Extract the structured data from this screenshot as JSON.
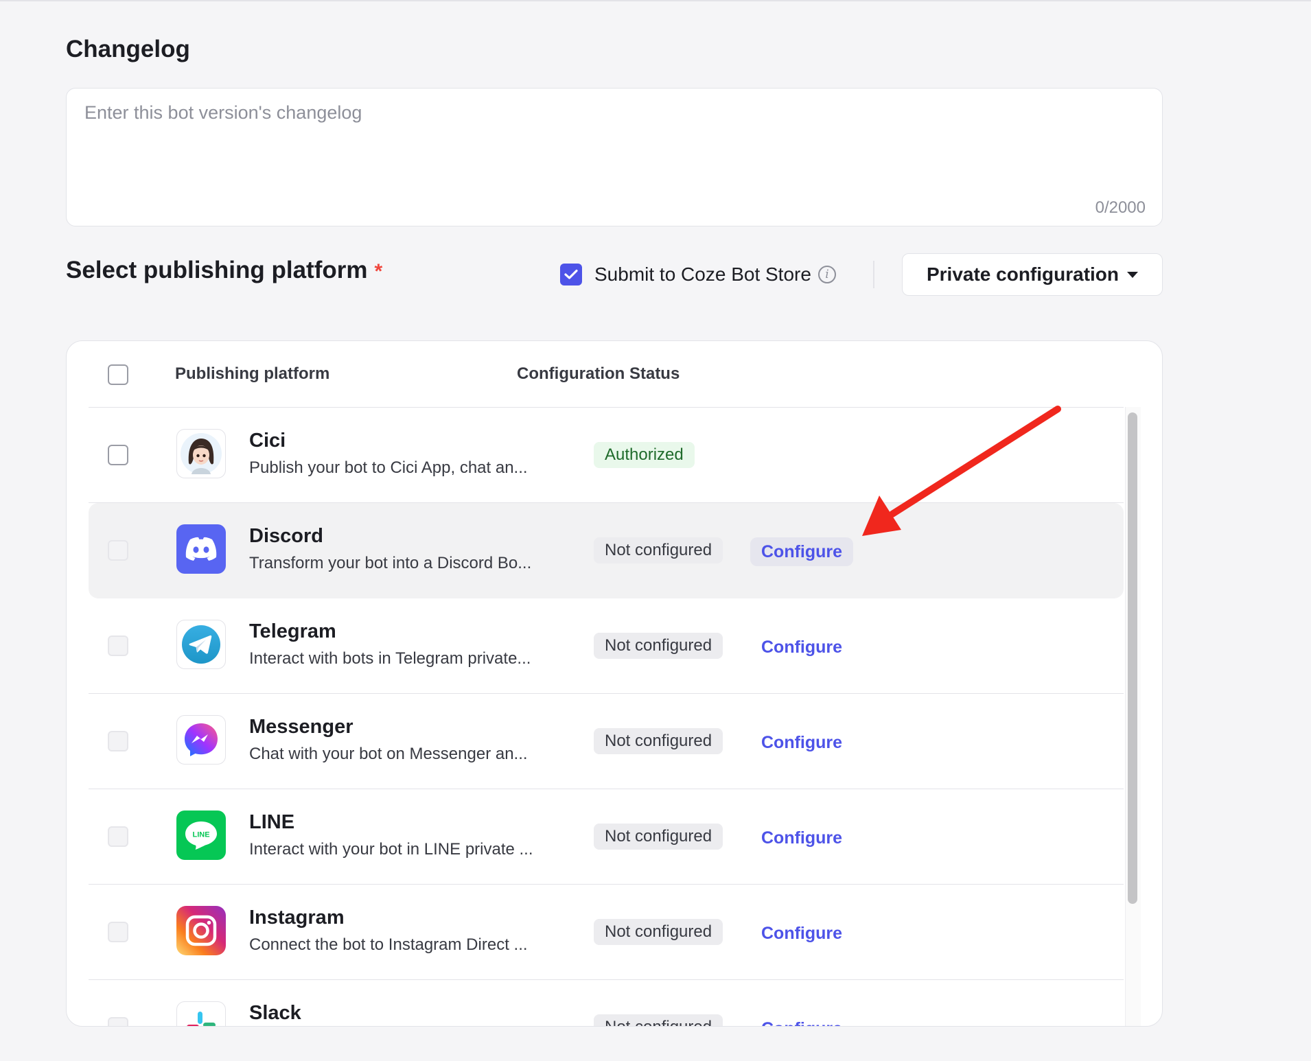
{
  "changelog": {
    "title": "Changelog",
    "placeholder": "Enter this bot version's changelog",
    "counter": "0/2000"
  },
  "publishing": {
    "title": "Select publishing platform",
    "required_mark": "*",
    "submit_label": "Submit to Coze Bot Store",
    "submit_checked": true,
    "private_config_label": "Private configuration"
  },
  "table": {
    "col_platform": "Publishing platform",
    "col_status": "Configuration Status",
    "rows": [
      {
        "name": "Cici",
        "desc": "Publish your bot to Cici App, chat an...",
        "status": "Authorized",
        "configure": "",
        "logo": "cici-avatar-icon",
        "checkbox_enabled": true
      },
      {
        "name": "Discord",
        "desc": "Transform your bot into a Discord Bo...",
        "status": "Not configured",
        "configure": "Configure",
        "logo": "discord-icon",
        "checkbox_enabled": false
      },
      {
        "name": "Telegram",
        "desc": "Interact with bots in Telegram private...",
        "status": "Not configured",
        "configure": "Configure",
        "logo": "telegram-icon",
        "checkbox_enabled": false
      },
      {
        "name": "Messenger",
        "desc": "Chat with your bot on Messenger an...",
        "status": "Not configured",
        "configure": "Configure",
        "logo": "messenger-icon",
        "checkbox_enabled": false
      },
      {
        "name": "LINE",
        "desc": "Interact with your bot in LINE private ...",
        "status": "Not configured",
        "configure": "Configure",
        "logo": "line-icon",
        "checkbox_enabled": false
      },
      {
        "name": "Instagram",
        "desc": "Connect the bot to Instagram Direct ...",
        "status": "Not configured",
        "configure": "Configure",
        "logo": "instagram-icon",
        "checkbox_enabled": false
      },
      {
        "name": "Slack",
        "desc": "",
        "status": "Not configured",
        "configure": "Configure",
        "logo": "slack-icon",
        "checkbox_enabled": false
      }
    ],
    "line_logo_text": "LINE"
  },
  "colors": {
    "accent": "#4d53e8",
    "annotation_arrow": "#f0271d",
    "authorized_bg": "#e9f8eb",
    "authorized_text": "#1f6b2b"
  }
}
